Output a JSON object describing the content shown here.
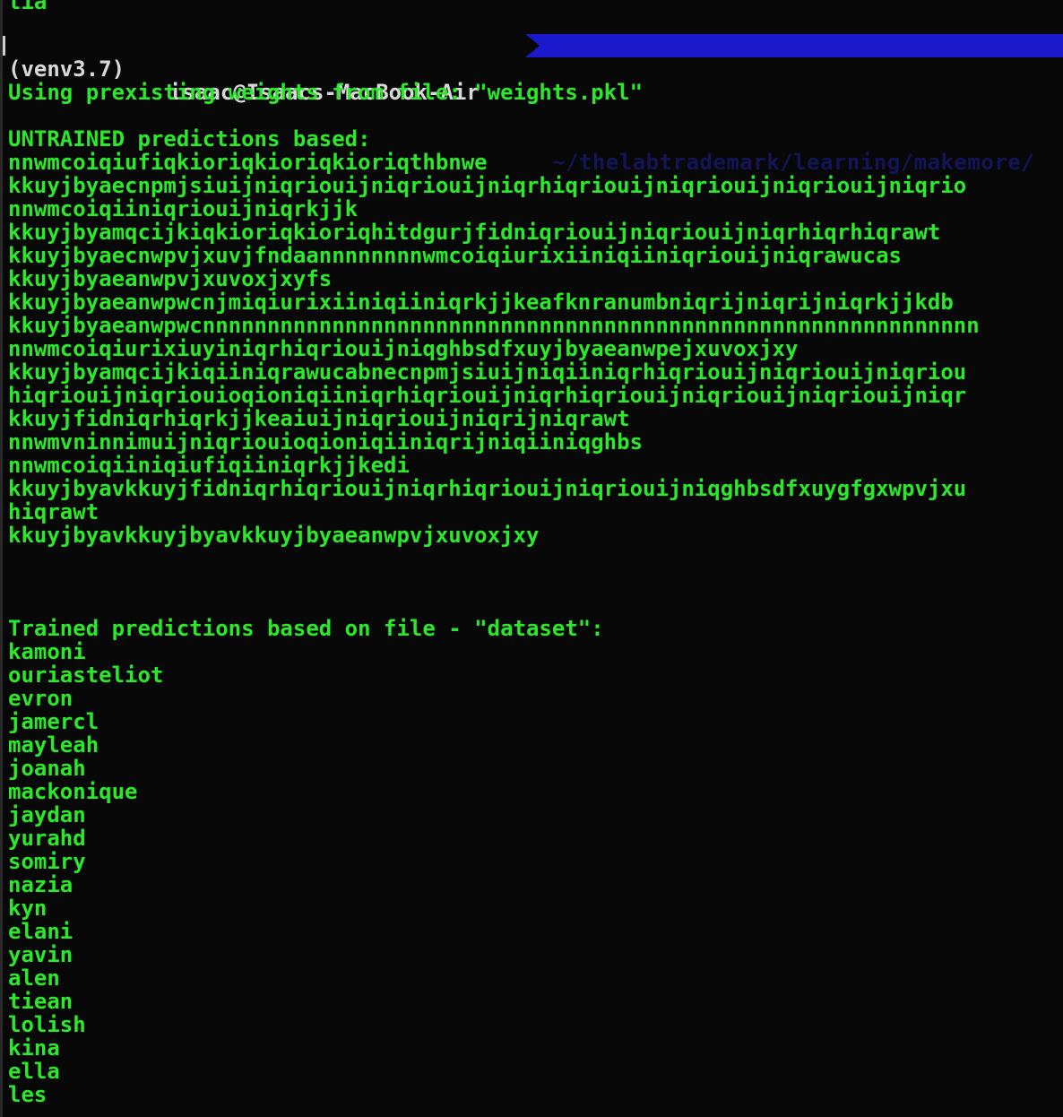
{
  "terminal": {
    "top_cut_line": "tia",
    "prompt": {
      "venv": "(venv3.7)",
      "user_host": "isaac@Isaacs-MacBook-Air",
      "path": "~/thelabtrademark/learning/makemore/"
    },
    "weights_msg": "Using prexisting weights from file: \"weights.pkl\"",
    "untrained_header": "UNTRAINED predictions based:",
    "untrained_lines": [
      "nnwmcoiqiufiqkioriqkioriqkioriqthbnwe",
      "kkuyjbyaecnpmjsiuijniqriouijniqriouijniqrhiqriouijniqriouijniqriouijniqrio",
      "nnwmcoiqiiniqriouijniqrkjjk",
      "kkuyjbyamqcijkiqkioriqkioriqhitdgurjfidniqriouijniqriouijniqrhiqrhiqrawt",
      "kkuyjbyaecnwpvjxuvjfndaannnnnnnnwmcoiqiurixiiniqiiniqriouijniqrawucas",
      "kkuyjbyaeanwpvjxuvoxjxyfs",
      "kkuyjbyaeanwpwcnjmiqiurixiiniqiiniqrkjjkeafknranumbniqrijniqrijniqrkjjkdb",
      "kkuyjbyaeanwpwcnnnnnnnnnnnnnnnnnnnnnnnnnnnnnnnnnnnnnnnnnnnnnnnnnnnnnnnnnnnn",
      "nnwmcoiqiurixiuyiniqrhiqriouijniqghbsdfxuyjbyaeanwpejxuvoxjxy",
      "kkuyjbyamqcijkiqiiniqrawucabnecnpmjsiuijniqiiniqrhiqriouijniqriouijniqriou",
      "hiqriouijniqriouioqioniqiiniqrhiqriouijniqrhiqriouijniqriouijniqriouijniqr",
      "kkuyjfidniqrhiqrkjjkeaiuijniqriouijniqrijniqrawt",
      "nnwmvninnimuijniqriouioqioniqiiniqrijniqiiniqghbs",
      "nnwmcoiqiiniqiufiqiiniqrkjjkedi",
      "kkuyjbyavkkuyjfidniqrhiqriouijniqrhiqriouijniqriouijniqghbsdfxuygfgxwpvjxu",
      "hiqrawt",
      "kkuyjbyavkkuyjbyavkkuyjbyaeanwpvjxuvoxjxy"
    ],
    "trained_header": "Trained predictions based on file - \"dataset\":",
    "trained_lines": [
      "kamoni",
      "ouriasteliot",
      "evron",
      "jamercl",
      "mayleah",
      "joanah",
      "mackonique",
      "jaydan",
      "yurahd",
      "somiry",
      "nazia",
      "kyn",
      "elani",
      "yavin",
      "alen",
      "tiean",
      "lolish",
      "kina",
      "ella",
      "les"
    ]
  },
  "colors": {
    "background": "#080808",
    "text_green": "#2ce82a",
    "prompt_white": "#d8d8d8",
    "path_bar_blue": "#1a1acc"
  }
}
